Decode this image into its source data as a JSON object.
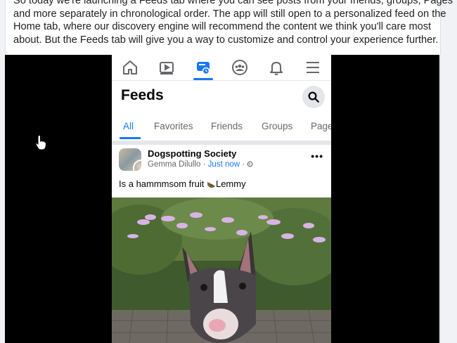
{
  "article": {
    "lines": [
      "So today we're launching a Feeds tab where you can see posts from your friends, groups, Pages",
      "and more separately in chronological order. The app will still open to a personalized feed on the",
      "Home tab, where our discovery engine will recommend the content we think you'll care most",
      "about. But the Feeds tab will give you a way to customize and control your experience further."
    ]
  },
  "nav": {
    "items": [
      {
        "icon": "home-icon"
      },
      {
        "icon": "video-icon"
      },
      {
        "icon": "feeds-icon"
      },
      {
        "icon": "groups-icon"
      },
      {
        "icon": "bell-icon"
      },
      {
        "icon": "menu-icon"
      }
    ],
    "active_index": 2
  },
  "feeds": {
    "title": "Feeds",
    "search_icon": "search-icon",
    "tabs": [
      "All",
      "Favorites",
      "Friends",
      "Groups",
      "Page"
    ],
    "active_tab": "All"
  },
  "post": {
    "group_name": "Dogspotting Society",
    "author": "Gemma Dilullo",
    "separator": "·",
    "time": "Just now",
    "privacy_icon": "globe-icon",
    "more": "•••",
    "caption_before": "Is a hammmsom fruit ",
    "caption_emoji": "watermelon-icon",
    "caption_after": "Lemmy"
  },
  "colors": {
    "accent": "#1877f2",
    "text": "#050505",
    "secondary_text": "#65676b",
    "video_bg": "#000000"
  }
}
